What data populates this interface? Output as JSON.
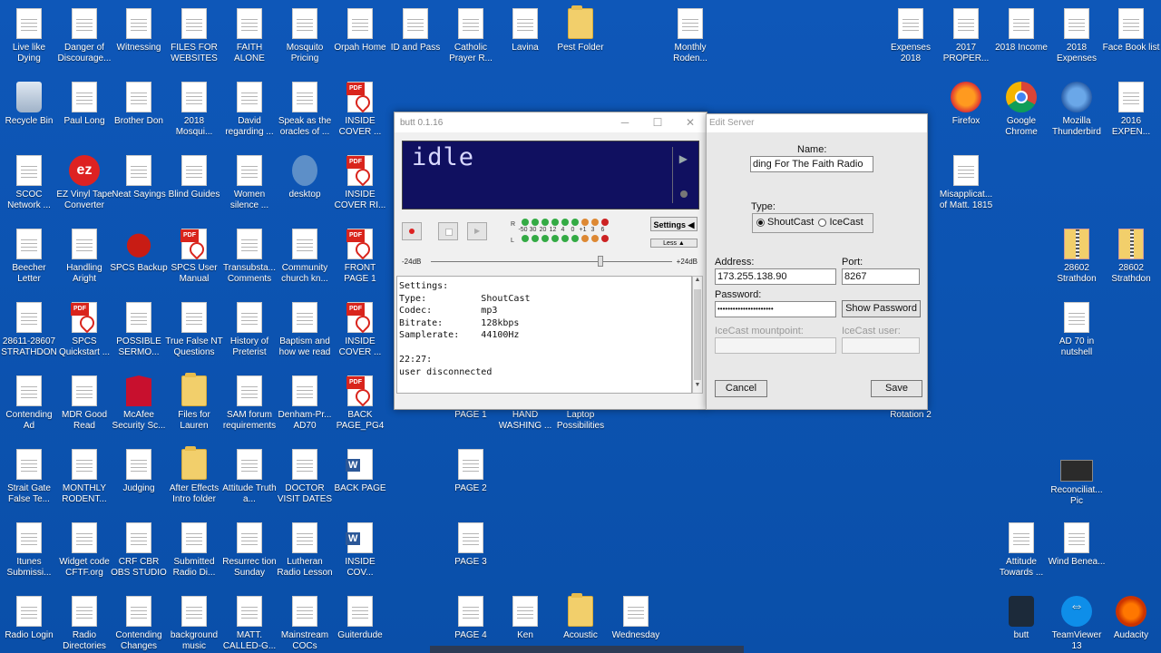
{
  "desktop": {
    "icons": [
      {
        "label": "Live like Dying",
        "type": "doc"
      },
      {
        "label": "Danger of Discourage...",
        "type": "doc"
      },
      {
        "label": "Witnessing",
        "type": "doc"
      },
      {
        "label": "FILES FOR WEBSITES",
        "type": "doc"
      },
      {
        "label": "FAITH ALONE",
        "type": "doc"
      },
      {
        "label": "Mosquito Pricing",
        "type": "doc"
      },
      {
        "label": "Orpah Home",
        "type": "doc"
      },
      {
        "label": "ID and Pass",
        "type": "doc"
      },
      {
        "label": "Catholic Prayer R...",
        "type": "doc"
      },
      {
        "label": "Lavina",
        "type": "doc"
      },
      {
        "label": "Pest Folder",
        "type": "folder"
      },
      {
        "label": "Monthly Roden...",
        "type": "doc"
      },
      {
        "label": "Expenses 2018",
        "type": "doc"
      },
      {
        "label": "2017 PROPER...",
        "type": "doc"
      },
      {
        "label": "2018 Income",
        "type": "doc"
      },
      {
        "label": "2018 Expenses",
        "type": "doc"
      },
      {
        "label": "Face Book list",
        "type": "doc"
      },
      {
        "label": "Recycle Bin",
        "type": "bin"
      },
      {
        "label": "Paul Long",
        "type": "doc"
      },
      {
        "label": "Brother Don",
        "type": "doc"
      },
      {
        "label": "2018 Mosqui...",
        "type": "doc"
      },
      {
        "label": "David regarding ...",
        "type": "doc"
      },
      {
        "label": "Speak as the oracles of ...",
        "type": "doc"
      },
      {
        "label": "INSIDE COVER ...",
        "type": "pdf"
      },
      {
        "label": "Firefox",
        "type": "ff"
      },
      {
        "label": "Google Chrome",
        "type": "chrome"
      },
      {
        "label": "Mozilla Thunderbird",
        "type": "tbird"
      },
      {
        "label": "2016 EXPEN...",
        "type": "doc"
      },
      {
        "label": "SCOC Network ...",
        "type": "doc"
      },
      {
        "label": "EZ Vinyl Tape Converter",
        "type": "ez"
      },
      {
        "label": "Neat Sayings",
        "type": "doc"
      },
      {
        "label": "Blind Guides",
        "type": "doc"
      },
      {
        "label": "Women silence ...",
        "type": "doc"
      },
      {
        "label": "desktop",
        "type": "gear"
      },
      {
        "label": "INSIDE COVER RI...",
        "type": "pdf"
      },
      {
        "label": "Misapplicat... of Matt. 1815",
        "type": "doc"
      },
      {
        "label": "Beecher Letter",
        "type": "doc"
      },
      {
        "label": "Handling Aright",
        "type": "doc"
      },
      {
        "label": "SPCS Backup",
        "type": "bug"
      },
      {
        "label": "SPCS User Manual",
        "type": "pdf"
      },
      {
        "label": "Transubsta... Comments",
        "type": "doc"
      },
      {
        "label": "Community church kn...",
        "type": "doc"
      },
      {
        "label": "FRONT PAGE 1",
        "type": "pdf"
      },
      {
        "label": "28602 Strathdon",
        "type": "zip"
      },
      {
        "label": "28602 Strathdon",
        "type": "zip"
      },
      {
        "label": "28611-28607 STRATHDON",
        "type": "doc"
      },
      {
        "label": "SPCS Quickstart ...",
        "type": "pdf"
      },
      {
        "label": "POSSIBLE SERMO...",
        "type": "doc"
      },
      {
        "label": "True False NT Questions",
        "type": "doc"
      },
      {
        "label": "History of Preterist",
        "type": "doc"
      },
      {
        "label": "Baptism and how we read",
        "type": "doc"
      },
      {
        "label": "INSIDE COVER ...",
        "type": "pdf"
      },
      {
        "label": "AD 70 in nutshell",
        "type": "doc"
      },
      {
        "label": "Contending Ad",
        "type": "doc"
      },
      {
        "label": "MDR Good Read",
        "type": "doc"
      },
      {
        "label": "McAfee Security Sc...",
        "type": "mcafee"
      },
      {
        "label": "Files for Lauren",
        "type": "folder"
      },
      {
        "label": "SAM forum requirements",
        "type": "doc"
      },
      {
        "label": "Denham-Pr... AD70",
        "type": "doc"
      },
      {
        "label": "BACK PAGE_PG4",
        "type": "pdf"
      },
      {
        "label": "PAGE 1",
        "type": "doc"
      },
      {
        "label": "HAND WASHING ...",
        "type": "doc"
      },
      {
        "label": "Laptop Possibilities",
        "type": "doc"
      },
      {
        "label": "Rotation 2",
        "type": "doc"
      },
      {
        "label": "Strait Gate False Te...",
        "type": "doc"
      },
      {
        "label": "MONTHLY RODENT...",
        "type": "doc"
      },
      {
        "label": "Judging",
        "type": "doc"
      },
      {
        "label": "After Effects Intro folder",
        "type": "folder"
      },
      {
        "label": "Attitude Truth a...",
        "type": "doc"
      },
      {
        "label": "DOCTOR VISIT DATES",
        "type": "doc"
      },
      {
        "label": "BACK PAGE",
        "type": "word"
      },
      {
        "label": "PAGE 2",
        "type": "doc"
      },
      {
        "label": "Reconciliat... Pic",
        "type": "photo"
      },
      {
        "label": "Itunes Submissi...",
        "type": "doc"
      },
      {
        "label": "Widget code CFTF.org",
        "type": "doc"
      },
      {
        "label": "CRF CBR OBS STUDIO",
        "type": "doc"
      },
      {
        "label": "Submitted Radio Di...",
        "type": "doc"
      },
      {
        "label": "Resurrec tion Sunday",
        "type": "doc"
      },
      {
        "label": "Lutheran Radio Lesson",
        "type": "doc"
      },
      {
        "label": "INSIDE COV...",
        "type": "word"
      },
      {
        "label": "PAGE 3",
        "type": "doc"
      },
      {
        "label": "Attitude Towards ...",
        "type": "doc"
      },
      {
        "label": "Wind Benea...",
        "type": "doc"
      },
      {
        "label": "Radio Login",
        "type": "doc"
      },
      {
        "label": "Radio Directories",
        "type": "doc"
      },
      {
        "label": "Contending Changes",
        "type": "doc"
      },
      {
        "label": "background music",
        "type": "doc"
      },
      {
        "label": "MATT. CALLED-G...",
        "type": "doc"
      },
      {
        "label": "Mainstream COCs",
        "type": "doc"
      },
      {
        "label": "Guiterdude",
        "type": "doc"
      },
      {
        "label": "PAGE 4",
        "type": "doc"
      },
      {
        "label": "Ken",
        "type": "doc"
      },
      {
        "label": "Acoustic",
        "type": "folder"
      },
      {
        "label": "Wednesday",
        "type": "doc"
      },
      {
        "label": "butt",
        "type": "speaker"
      },
      {
        "label": "TeamViewer 13",
        "type": "tv"
      },
      {
        "label": "Audacity",
        "type": "aud"
      }
    ]
  },
  "butt": {
    "title": "butt 0.1.16",
    "display": "idle",
    "minimize": "─",
    "maximize": "☐",
    "close": "✕",
    "record_icon": "record-icon",
    "vu": {
      "r_label": "R",
      "l_label": "L",
      "scale": [
        "-50",
        "30",
        "20",
        "12",
        "4",
        "0",
        "+1",
        "3",
        "6"
      ]
    },
    "settings_label": "Settings ◀",
    "less_label": "Less ▲",
    "gain_min": "-24dB",
    "gain_max": "+24dB",
    "gain_value_db": 8,
    "log": "Settings:\nType:          ShoutCast\nCodec:         mp3\nBitrate:       128kbps\nSamplerate:    44100Hz\n\n22:27:\nuser disconnected"
  },
  "edit_server": {
    "title": "Edit Server",
    "name_label": "Name:",
    "name_value": "ding For The Faith Radio",
    "type_label": "Type:",
    "type_shoutcast": "ShoutCast",
    "type_icecast": "IceCast",
    "address_label": "Address:",
    "address_value": "173.255.138.90",
    "port_label": "Port:",
    "port_value": "8267",
    "password_label": "Password:",
    "password_value": "••••••••••••••••••••••",
    "show_password": "Show Password",
    "mountpoint_label": "IceCast mountpoint:",
    "user_label": "IceCast user:",
    "cancel": "Cancel",
    "save": "Save"
  }
}
